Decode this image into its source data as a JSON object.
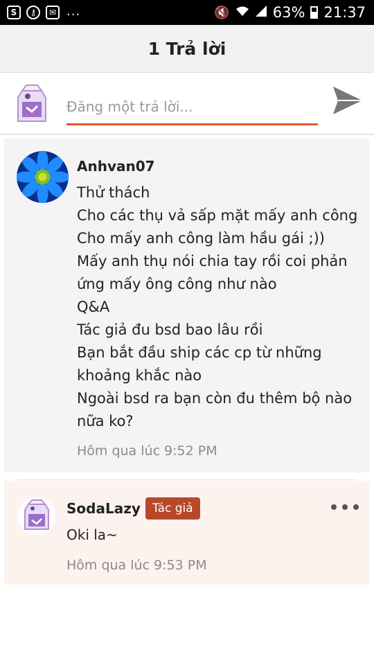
{
  "status_bar": {
    "dots": "...",
    "battery": "63%",
    "time": "21:37",
    "icons": [
      "skype-icon",
      "key-icon",
      "mail-icon",
      "mute-icon",
      "wifi-icon",
      "signal-icon",
      "battery-icon"
    ]
  },
  "header": {
    "title": "1 Trả lời"
  },
  "composer": {
    "placeholder": "Đăng một trả lời...",
    "value": ""
  },
  "comments": [
    {
      "author": "Anhvan07",
      "lines": [
        "Thử thách",
        "Cho các thụ vả sấp mặt mấy anh công",
        "Cho mấy anh công làm hầu gái ;))",
        "Mấy anh thụ nói chia tay rồi coi phản ứng mấy ông công như nào",
        "Q&A",
        "Tác giả đu bsd bao lâu rồi",
        "Bạn bắt đầu ship các cp từ những khoảng khắc nào",
        "Ngoài bsd ra bạn còn đu thêm bộ nào nữa ko?"
      ],
      "time": "Hôm qua lúc 9:52 PM"
    },
    {
      "author": "SodaLazy",
      "badge": "Tác giả",
      "text": "Oki la~",
      "time": "Hôm qua lúc 9:53 PM"
    }
  ],
  "colors": {
    "accent": "#e4572a",
    "badge": "#b8482a",
    "reply_bg": "#fdf3ee"
  }
}
